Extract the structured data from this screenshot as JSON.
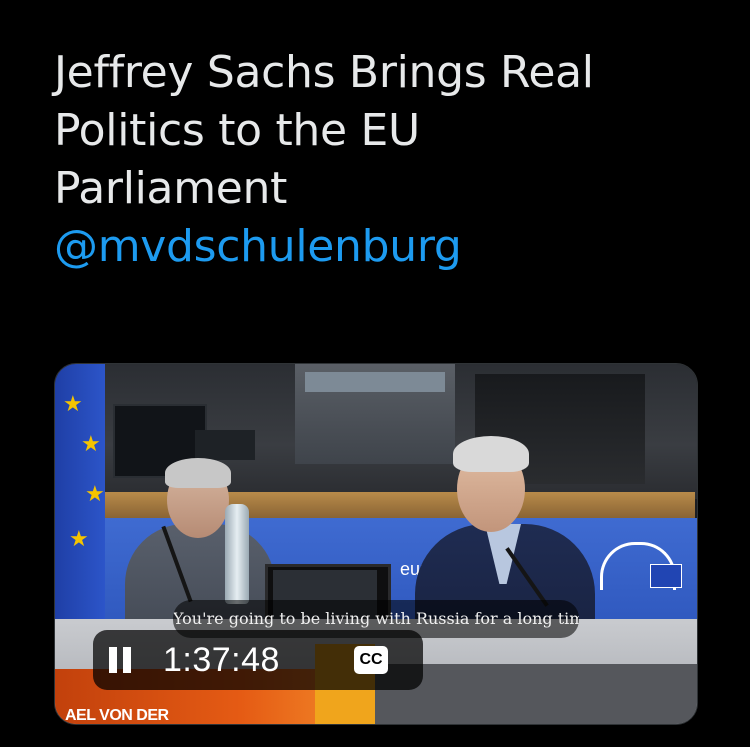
{
  "tweet": {
    "text_lines": [
      "Jeffrey Sachs Brings Real",
      "Politics to the EU",
      "Parliament"
    ],
    "mention": "@mvdschulenburg"
  },
  "video": {
    "caption": "You're going to be living with Russia for a long time",
    "time": "1:37:48",
    "cc_label": "CC",
    "state": "playing",
    "play_pause_icon": "pause-icon",
    "scene_text": {
      "backdrop_text": "eur",
      "name_plate": "AEL VON DER"
    }
  },
  "colors": {
    "background": "#000000",
    "text": "#e7e9ea",
    "mention": "#1d9bf0"
  }
}
